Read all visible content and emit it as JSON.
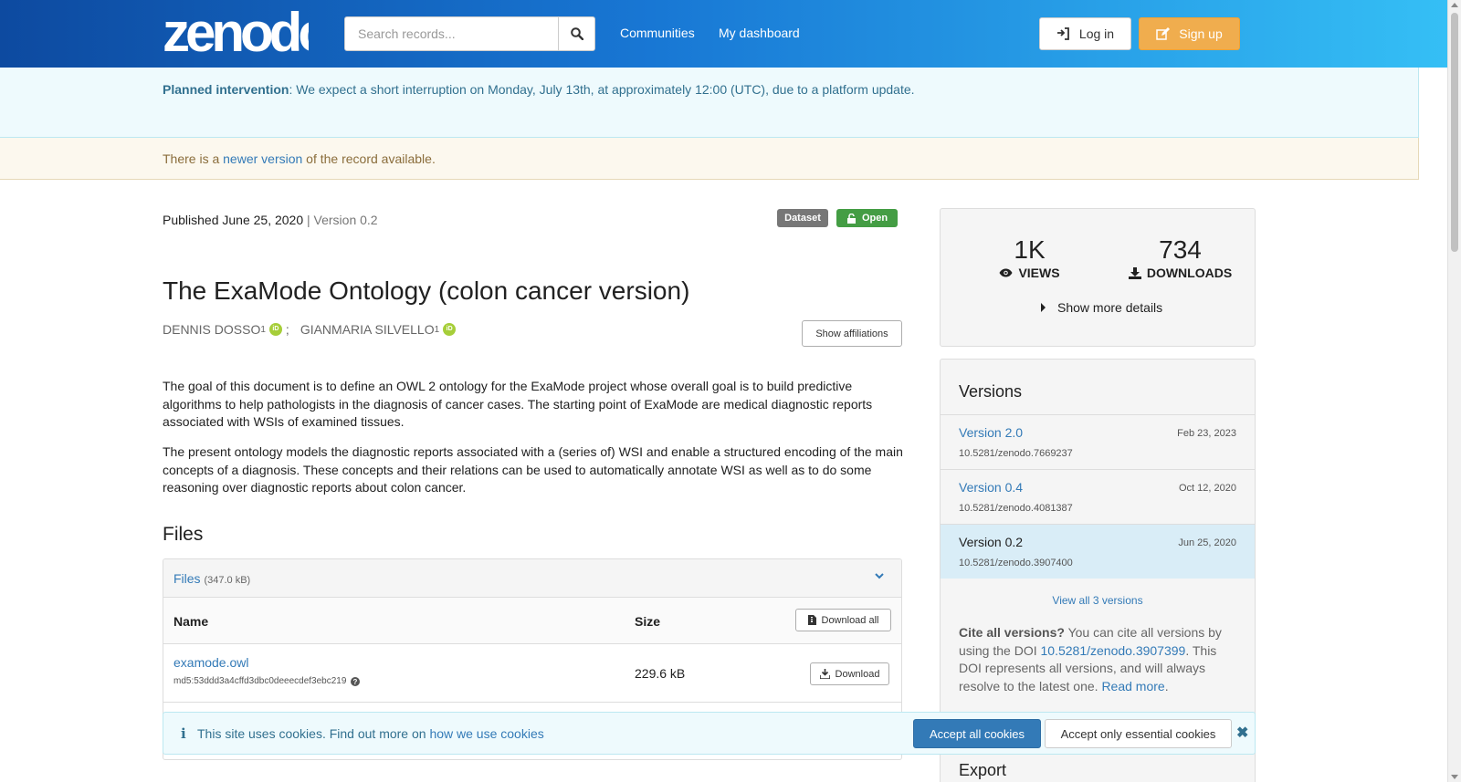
{
  "header": {
    "logo_text": "zenodo",
    "search_placeholder": "Search records...",
    "nav": [
      "Communities",
      "My dashboard"
    ],
    "login_label": "Log in",
    "signup_label": "Sign up"
  },
  "banners": {
    "intervention_bold": "Planned intervention",
    "intervention_text": ": We expect a short interruption on Monday, July 13th, at approximately 12:00 (UTC), due to a platform update.",
    "newer_prefix": "There is a ",
    "newer_link": "newer version",
    "newer_suffix": " of the record available."
  },
  "record": {
    "published": "Published June 25, 2020",
    "version_sep": " | ",
    "version": "Version 0.2",
    "badge_type": "Dataset",
    "badge_access": "Open",
    "title": "The ExaMode Ontology (colon cancer version)",
    "authors": [
      {
        "name": "DENNIS DOSSO",
        "aff": "1",
        "sep": ";"
      },
      {
        "name": "GIANMARIA SILVELLO",
        "aff": "1",
        "sep": ""
      }
    ],
    "affiliations_btn": "Show affiliations",
    "description": [
      "The goal of this document is to define an OWL 2 ontology for the ExaMode project whose overall goal is to build predictive algorithms to help pathologists in the diagnosis of cancer cases. The starting point of ExaMode are medical diagnostic reports associated with WSIs of examined tissues.",
      "The present ontology models the diagnostic reports associated with a (series of) WSI and enable a structured encoding of the main concepts of a diagnosis. These concepts and their relations can be used to automatically annotate WSI as well as to do some reasoning over diagnostic reports about colon cancer."
    ]
  },
  "files": {
    "heading": "Files",
    "panel_label": "Files",
    "panel_size": "(347.0 kB)",
    "col_name": "Name",
    "col_size": "Size",
    "download_all": "Download all",
    "rows": [
      {
        "name": "examode.owl",
        "md5": "md5:53ddd3a4cffd3dbc0deeecdef3ebc219",
        "size": "229.6 kB",
        "download": "Download"
      }
    ]
  },
  "stats": {
    "views_num": "1K",
    "views_label": "VIEWS",
    "downloads_num": "734",
    "downloads_label": "DOWNLOADS",
    "more_details": "Show more details"
  },
  "versions": {
    "title": "Versions",
    "items": [
      {
        "name": "Version 2.0",
        "date": "Feb 23, 2023",
        "doi": "10.5281/zenodo.7669237",
        "active": false
      },
      {
        "name": "Version 0.4",
        "date": "Oct 12, 2020",
        "doi": "10.5281/zenodo.4081387",
        "active": false
      },
      {
        "name": "Version 0.2",
        "date": "Jun 25, 2020",
        "doi": "10.5281/zenodo.3907400",
        "active": true
      }
    ],
    "view_all": "View all 3 versions",
    "cite_bold": "Cite all versions?",
    "cite_text1": " You can cite all versions by using the DOI ",
    "cite_doi": "10.5281/zenodo.3907399",
    "cite_text2": ". This DOI represents all versions, and will always resolve to the latest one. ",
    "cite_read_more": "Read more",
    "cite_end": "."
  },
  "cookie": {
    "text": "This site uses cookies. Find out more on ",
    "link": "how we use cookies",
    "accept_all": "Accept all cookies",
    "accept_essential": "Accept only essential cookies"
  },
  "sidebar_peek": "Export"
}
